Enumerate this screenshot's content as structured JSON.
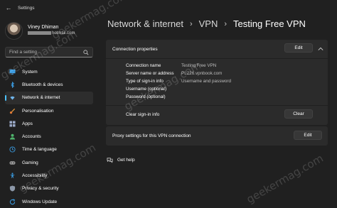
{
  "window": {
    "title": "Settings"
  },
  "profile": {
    "name": "Viney Dhiman",
    "email": "hotmail.com"
  },
  "search": {
    "placeholder": "Find a setting"
  },
  "sidebar": {
    "items": [
      {
        "label": "System",
        "icon": "monitor-icon"
      },
      {
        "label": "Bluetooth & devices",
        "icon": "bluetooth-icon"
      },
      {
        "label": "Network & internet",
        "icon": "wifi-icon",
        "active": true
      },
      {
        "label": "Personalisation",
        "icon": "brush-icon"
      },
      {
        "label": "Apps",
        "icon": "apps-icon"
      },
      {
        "label": "Accounts",
        "icon": "person-icon"
      },
      {
        "label": "Time & language",
        "icon": "globe-clock-icon"
      },
      {
        "label": "Gaming",
        "icon": "gamepad-icon"
      },
      {
        "label": "Accessibility",
        "icon": "accessibility-icon"
      },
      {
        "label": "Privacy & security",
        "icon": "shield-icon"
      },
      {
        "label": "Windows Update",
        "icon": "update-icon"
      }
    ]
  },
  "breadcrumb": {
    "items": [
      "Network & internet",
      "VPN",
      "Testing Free VPN"
    ]
  },
  "connection_properties": {
    "label": "Connection properties",
    "edit_label": "Edit",
    "rows": [
      {
        "label": "Connection name",
        "value": "Testing Free VPN"
      },
      {
        "label": "Server name or address",
        "value": "PL226.vpnbook.com"
      },
      {
        "label": "Type of sign-in info",
        "value": "Username and password"
      },
      {
        "label": "Username (optional)",
        "value": ""
      },
      {
        "label": "Password (optional)",
        "value": ""
      }
    ],
    "clear_label": "Clear sign-in info",
    "clear_button": "Clear"
  },
  "proxy": {
    "label": "Proxy settings for this VPN connection",
    "edit_label": "Edit"
  },
  "help": {
    "label": "Get help"
  },
  "watermark": {
    "text": "geekermag.com"
  },
  "colors": {
    "accent": "#4cc2ff",
    "background": "#202020",
    "card": "#2b2b2b"
  }
}
